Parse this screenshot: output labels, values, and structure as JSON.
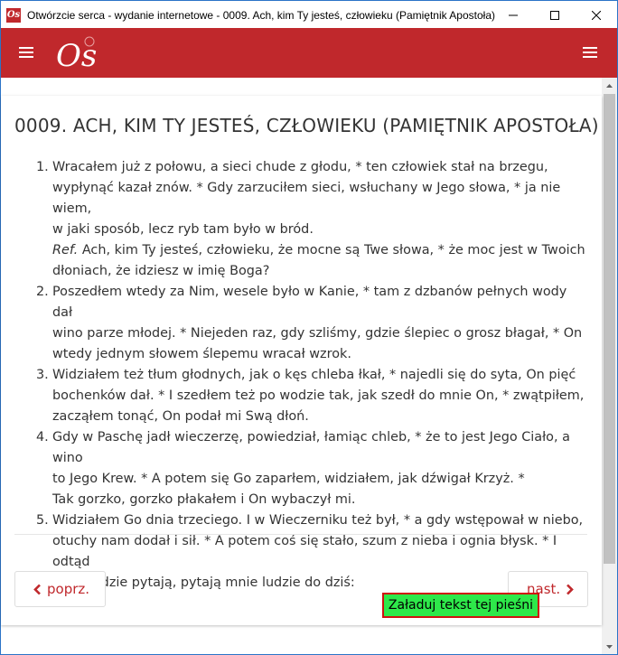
{
  "window": {
    "title": "Otwórzcie serca - wydanie internetowe - 0009. Ach, kim Ty jesteś, człowieku (Pamiętnik Apostoła)",
    "icon_text": "Os"
  },
  "header": {
    "logo_text": "Os",
    "menu_left_icon": "hamburger-icon",
    "menu_right_icon": "hamburger-icon",
    "brand_color": "#c0282c"
  },
  "song": {
    "title": "0009. ACH, KIM TY JESTEŚ, CZŁOWIEKU (PAMIĘTNIK APOSTOŁA)",
    "verses": [
      {
        "number": "1.",
        "lines": [
          "Wracałem już z połowu, a sieci chude z głodu, * ten człowiek stał na brzegu,",
          "wypłynąć kazał znów. * Gdy zarzuciłem sieci, wsłuchany w Jego słowa, * ja nie wiem,",
          "w jaki sposób, lecz ryb tam było w bród."
        ],
        "ref_label": "Ref.",
        "ref_lines": [
          " Ach, kim Ty jesteś, człowieku, że mocne są Twe słowa, * że moc jest w Twoich",
          "dłoniach, że idziesz w imię Boga?"
        ]
      },
      {
        "number": "2.",
        "lines": [
          "Poszedłem wtedy za Nim, wesele było w Kanie, * tam z dzbanów pełnych wody dał",
          "wino parze młodej. * Niejeden raz, gdy szliśmy, gdzie ślepiec o grosz błagał, * On",
          "wtedy jednym słowem ślepemu wracał wzrok."
        ]
      },
      {
        "number": "3.",
        "lines": [
          "Widziałem też tłum głodnych, jak o kęs chleba łkał, * najedli się do syta, On pięć",
          "bochenków dał. * I szedłem też po wodzie tak, jak szedł do mnie On, * zwątpiłem,",
          "zacząłem tonąć, On podał mi Swą dłoń."
        ]
      },
      {
        "number": "4.",
        "lines": [
          "Gdy w Paschę jadł wieczerzę, powiedział, łamiąc chleb, * że to jest Jego Ciało, a wino",
          "to Jego Krew. * A potem się Go zaparłem, widziałem, jak dźwigał Krzyż. *",
          "Tak gorzko, gorzko płakałem i On wybaczył mi."
        ]
      },
      {
        "number": "5.",
        "lines": [
          "Widziałem Go dnia trzeciego. I w Wieczerniku też był, * a gdy wstępował w niebo,",
          "otuchy nam dodał i sił. * A potem coś się stało, szum z nieba i ognia błysk. * I odtąd",
          "mnie ludzie pytają, pytają mnie ludzie do dziś:"
        ]
      }
    ]
  },
  "nav": {
    "prev_label": "poprz.",
    "next_label": "nast.",
    "prev_icon": "chevron-left-icon",
    "next_icon": "chevron-right-icon"
  },
  "load_button": {
    "label": "Załaduj tekst tej pieśni",
    "bg_color": "#2ee84a",
    "border_color": "#d01010"
  }
}
